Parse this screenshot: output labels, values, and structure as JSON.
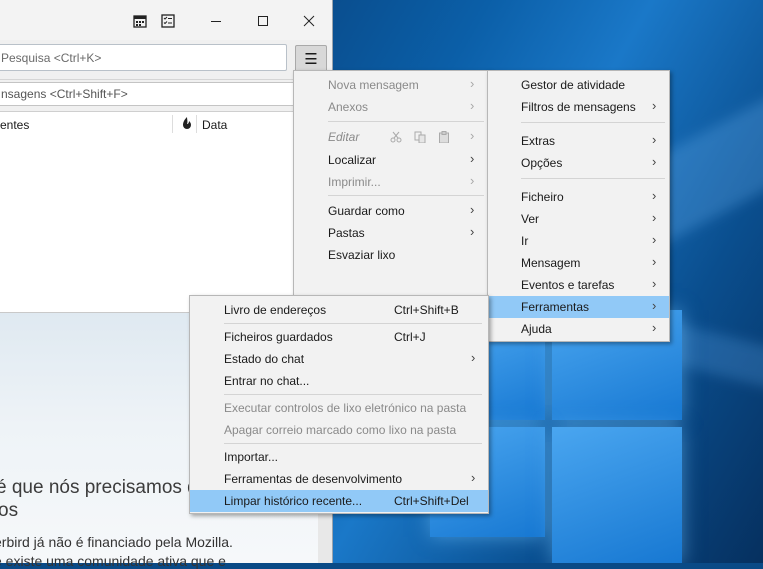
{
  "window": {
    "search_placeholder": "Pesquisa <Ctrl+K>",
    "filter_placeholder": "nsagens <Ctrl+Shift+F>",
    "columns": {
      "first": "entes",
      "date": "Data"
    }
  },
  "start_page": {
    "heading_line1": "é que nós precisamos d",
    "heading_line2": "os",
    "text_line1": "erbird já não é financiado pela Mozilla.",
    "text_line2": "e existe uma comunidade ativa que e"
  },
  "left_menu": {
    "items": [
      {
        "label": "Nova mensagem",
        "disabled": true,
        "submenu": true
      },
      {
        "label": "Anexos",
        "disabled": true,
        "submenu": true
      },
      {
        "label": "Editar",
        "disabled": true,
        "submenu": true
      },
      {
        "label": "Localizar",
        "disabled": false,
        "submenu": true
      },
      {
        "label": "Imprimir...",
        "disabled": true,
        "submenu": true
      },
      {
        "label": "Guardar como",
        "disabled": false,
        "submenu": true
      },
      {
        "label": "Pastas",
        "disabled": false,
        "submenu": true
      },
      {
        "label": "Esvaziar lixo",
        "disabled": false,
        "submenu": false
      }
    ]
  },
  "right_menu": {
    "items": [
      {
        "label": "Gestor de atividade",
        "submenu": false
      },
      {
        "label": "Filtros de mensagens",
        "submenu": true
      },
      {
        "label": "Extras",
        "submenu": true
      },
      {
        "label": "Opções",
        "submenu": true
      },
      {
        "label": "Ficheiro",
        "submenu": true
      },
      {
        "label": "Ver",
        "submenu": true
      },
      {
        "label": "Ir",
        "submenu": true
      },
      {
        "label": "Mensagem",
        "submenu": true
      },
      {
        "label": "Eventos e tarefas",
        "submenu": true
      },
      {
        "label": "Ferramentas",
        "submenu": true,
        "highlighted": true
      },
      {
        "label": "Ajuda",
        "submenu": true
      }
    ]
  },
  "tools_menu": {
    "items": [
      {
        "label": "Livro de endereços",
        "shortcut": "Ctrl+Shift+B"
      },
      {
        "label": "Ficheiros guardados",
        "shortcut": "Ctrl+J"
      },
      {
        "label": "Estado do chat",
        "shortcut": "",
        "submenu": true
      },
      {
        "label": "Entrar no chat...",
        "shortcut": ""
      },
      {
        "label": "Executar controlos de lixo eletrónico na pasta",
        "shortcut": "",
        "disabled": true
      },
      {
        "label": "Apagar correio marcado como lixo na pasta",
        "shortcut": "",
        "disabled": true
      },
      {
        "label": "Importar...",
        "shortcut": ""
      },
      {
        "label": "Ferramentas de desenvolvimento",
        "shortcut": "",
        "submenu": true
      },
      {
        "label": "Limpar histórico recente...",
        "shortcut": "Ctrl+Shift+Del",
        "highlighted": true
      }
    ]
  },
  "glyphs": {
    "submenu_arrow": "›",
    "hamburger": "☰"
  },
  "icons": [
    "calendar-icon",
    "tasks-icon",
    "minimize-icon",
    "maximize-icon",
    "close-icon",
    "hamburger-menu-icon",
    "cut-icon",
    "copy-icon",
    "paste-icon",
    "thread-status-icon"
  ]
}
